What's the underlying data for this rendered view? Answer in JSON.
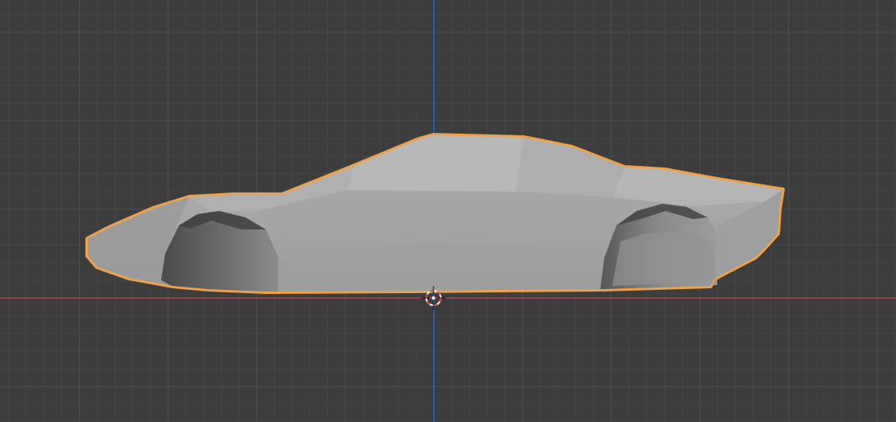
{
  "viewport": {
    "view": "side-orthographic",
    "background_color": "#3d3d3d",
    "grid_minor_color": "#454545",
    "grid_major_color": "#4d4d4d",
    "x_axis_color": "#c9424d",
    "z_axis_color": "#3a70c2",
    "selection_outline_color": "#f0a046"
  },
  "object": {
    "kind": "car-body-mesh",
    "selected": true,
    "shading": "solid",
    "base_color": "#a8a8a8"
  },
  "cursor": {
    "icon": "3d-cursor-icon",
    "ring_color_a": "#d8443c",
    "ring_color_b": "#f2f2f2"
  }
}
